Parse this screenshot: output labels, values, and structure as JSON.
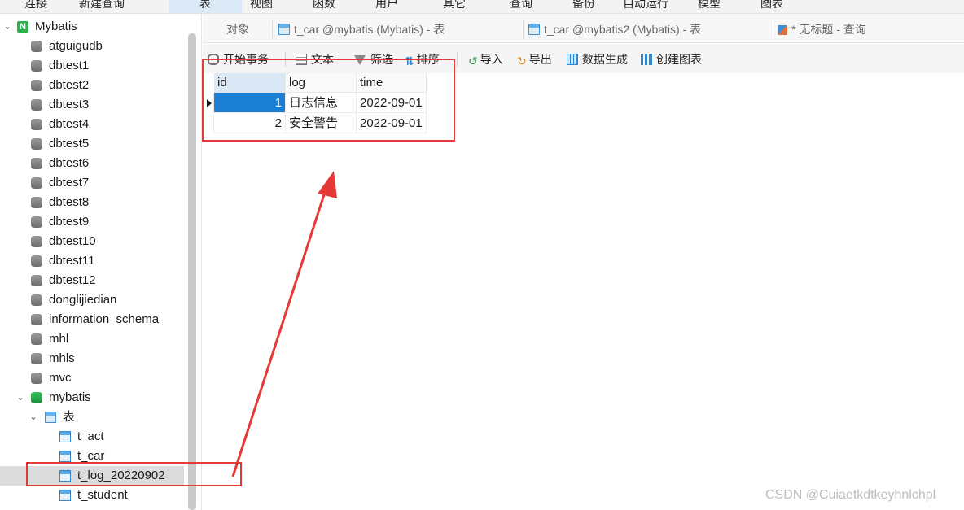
{
  "menubar": {
    "items": [
      "连接",
      "新建查询",
      "表",
      "视图",
      "函数",
      "用户",
      "其它",
      "查询",
      "备份",
      "自动运行",
      "模型",
      "图表"
    ]
  },
  "sidebar": {
    "connection": "Mybatis",
    "databases": [
      "atguigudb",
      "dbtest1",
      "dbtest2",
      "dbtest3",
      "dbtest4",
      "dbtest5",
      "dbtest6",
      "dbtest7",
      "dbtest8",
      "dbtest9",
      "dbtest10",
      "dbtest11",
      "dbtest12",
      "donglijiedian",
      "information_schema",
      "mhl",
      "mhls",
      "mvc"
    ],
    "open_db": "mybatis",
    "tables_group": "表",
    "tables": [
      "t_act",
      "t_car",
      "t_log_20220902",
      "t_student"
    ],
    "selected_table": "t_log_20220902"
  },
  "tabs": {
    "objects": "对象",
    "tab1": "t_car @mybatis (Mybatis) - 表",
    "tab2": "t_car @mybatis2 (Mybatis) - 表",
    "tab3": "* 无标题 - 查询"
  },
  "toolbar": {
    "begin_tx": "开始事务",
    "text": "文本",
    "filter": "筛选",
    "sort": "排序",
    "import": "导入",
    "export": "导出",
    "datagen": "数据生成",
    "chart": "创建图表"
  },
  "grid": {
    "columns": [
      "id",
      "log",
      "time"
    ],
    "rows": [
      {
        "id": "1",
        "log": "日志信息",
        "time": "2022-09-01"
      },
      {
        "id": "2",
        "log": "安全警告",
        "time": "2022-09-01"
      }
    ]
  },
  "watermark": "CSDN @Cuiaetkdtkeyhnlchpl",
  "colors": {
    "accent": "#1c7fd6",
    "annotation": "#e53935"
  }
}
